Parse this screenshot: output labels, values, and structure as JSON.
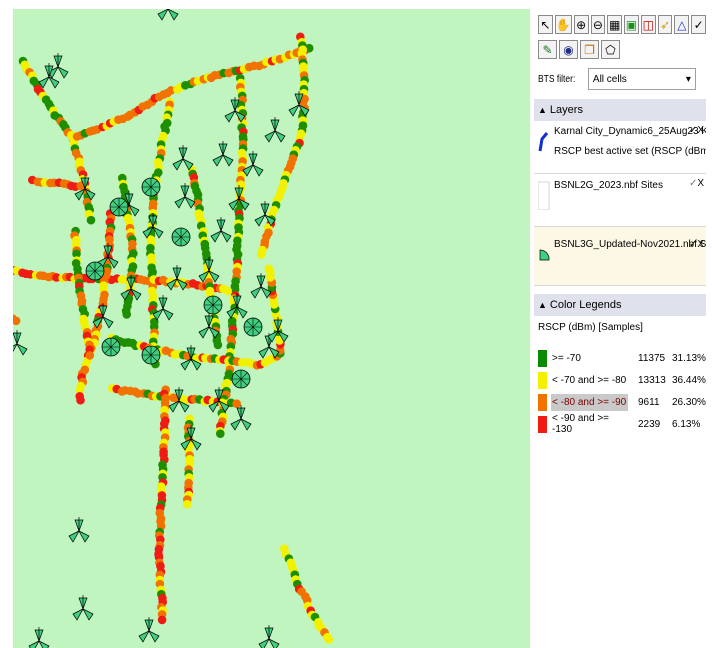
{
  "map": {
    "background": "#c0f5c0",
    "sample_colors": {
      "green": "#1e8f00",
      "yellow": "#f2f200",
      "orange": "#f27200",
      "red": "#ee1c12"
    },
    "site_icon": "bts-site-antenna-icon"
  },
  "toolbar": {
    "row1": [
      "pointer-icon",
      "hand-pan-icon",
      "zoom-in-icon",
      "zoom-out-icon",
      "grid-icon",
      "select-area-icon",
      "measure-icon",
      "route-icon",
      "triangle-icon",
      "checkmark-icon"
    ],
    "row2": [
      "site-edit-icon",
      "globe-icon",
      "layer-copy-icon",
      "polygon-select-icon"
    ]
  },
  "bts_filter": {
    "label": "BTS filter:",
    "value": "All cells"
  },
  "layers_header": "Layers",
  "layers": [
    {
      "name": "Karnal City_Dynamic6_25Aug23 Karna",
      "sub": "RSCP best active set (RSCP (dBm))",
      "visible": "✓",
      "remove": "X",
      "icon": "route-line-icon"
    },
    {
      "name": "BSNL2G_2023.nbf Sites",
      "sub": "",
      "visible": "✓",
      "remove": "X",
      "icon": "blank-layer-icon"
    },
    {
      "name": "BSNL3G_Updated-Nov2021.nbf Sites",
      "sub": "",
      "visible": "✓",
      "remove": "X",
      "icon": "site-sector-icon"
    }
  ],
  "legend_header": "Color Legends",
  "legend_title": "RSCP (dBm) [Samples]",
  "legend": [
    {
      "label": ">= -70",
      "count": "11375",
      "percent": "31.13%",
      "color": "#0a8a00",
      "fraction": 0.3113
    },
    {
      "label": "< -70 and >= -80",
      "count": "13313",
      "percent": "36.44%",
      "color": "#f2f200",
      "fraction": 0.3644
    },
    {
      "label": "< -80 and >= -90",
      "count": "9611",
      "percent": "26.30%",
      "color": "#f27200",
      "fraction": 0.263
    },
    {
      "label": "< -90 and >= -130",
      "count": "2239",
      "percent": "6.13%",
      "color": "#ee1c12",
      "fraction": 0.0613
    }
  ]
}
